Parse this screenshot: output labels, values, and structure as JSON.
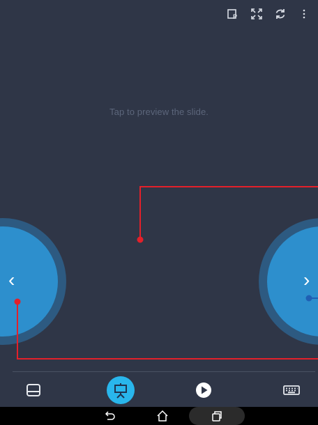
{
  "top_actions": [
    {
      "name": "presenter-view-icon"
    },
    {
      "name": "fullscreen-icon"
    },
    {
      "name": "refresh-icon"
    },
    {
      "name": "more-options-icon"
    }
  ],
  "main": {
    "hint_text": "Tap to preview the slide.",
    "prev_arrow": "‹",
    "next_arrow": "›"
  },
  "toolbar": {
    "items": [
      {
        "name": "touchpad-icon",
        "active": false
      },
      {
        "name": "presentation-icon",
        "active": true
      },
      {
        "name": "play-icon",
        "active": false
      },
      {
        "name": "keyboard-icon",
        "active": false
      }
    ]
  },
  "system_nav": {
    "buttons": [
      "back-icon",
      "home-icon",
      "recent-apps-icon"
    ]
  },
  "colors": {
    "background": "#2f3647",
    "accent": "#29b6ec",
    "circle": "#2d8fcd",
    "callout_red": "#e3202a",
    "callout_blue": "#1f5fb4"
  }
}
